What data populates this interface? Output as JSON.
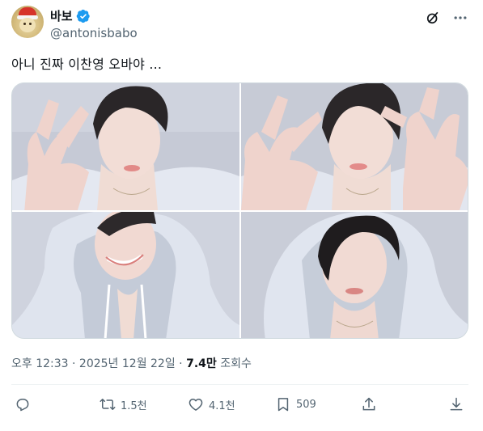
{
  "author": {
    "display_name": "바보",
    "handle": "@antonisbabo",
    "verified": true,
    "verified_color": "#1d9bf0"
  },
  "header_icons": [
    "grok-icon",
    "more-icon"
  ],
  "tweet": {
    "text": "아니 진짜 이찬영 오바야 ..."
  },
  "media": {
    "count": 4,
    "photos": [
      "photo-1",
      "photo-2",
      "photo-3",
      "photo-4"
    ]
  },
  "meta": {
    "time": "오후 12:33",
    "sep1": " · ",
    "date": "2025년 12월 22일",
    "sep2": " · ",
    "views": "7.4만",
    "views_label": " 조회수"
  },
  "actions": {
    "reply": {
      "icon": "reply-icon",
      "count": ""
    },
    "retweet": {
      "icon": "retweet-icon",
      "count": "1.5천"
    },
    "like": {
      "icon": "heart-icon",
      "count": "4.1천"
    },
    "bookmark": {
      "icon": "bookmark-icon",
      "count": "509"
    },
    "share": {
      "icon": "share-icon",
      "count": ""
    },
    "download": {
      "icon": "download-icon",
      "count": ""
    }
  },
  "colors": {
    "text_primary": "#0f1419",
    "text_secondary": "#536471",
    "accent": "#1d9bf0",
    "border": "#cfd9de"
  }
}
